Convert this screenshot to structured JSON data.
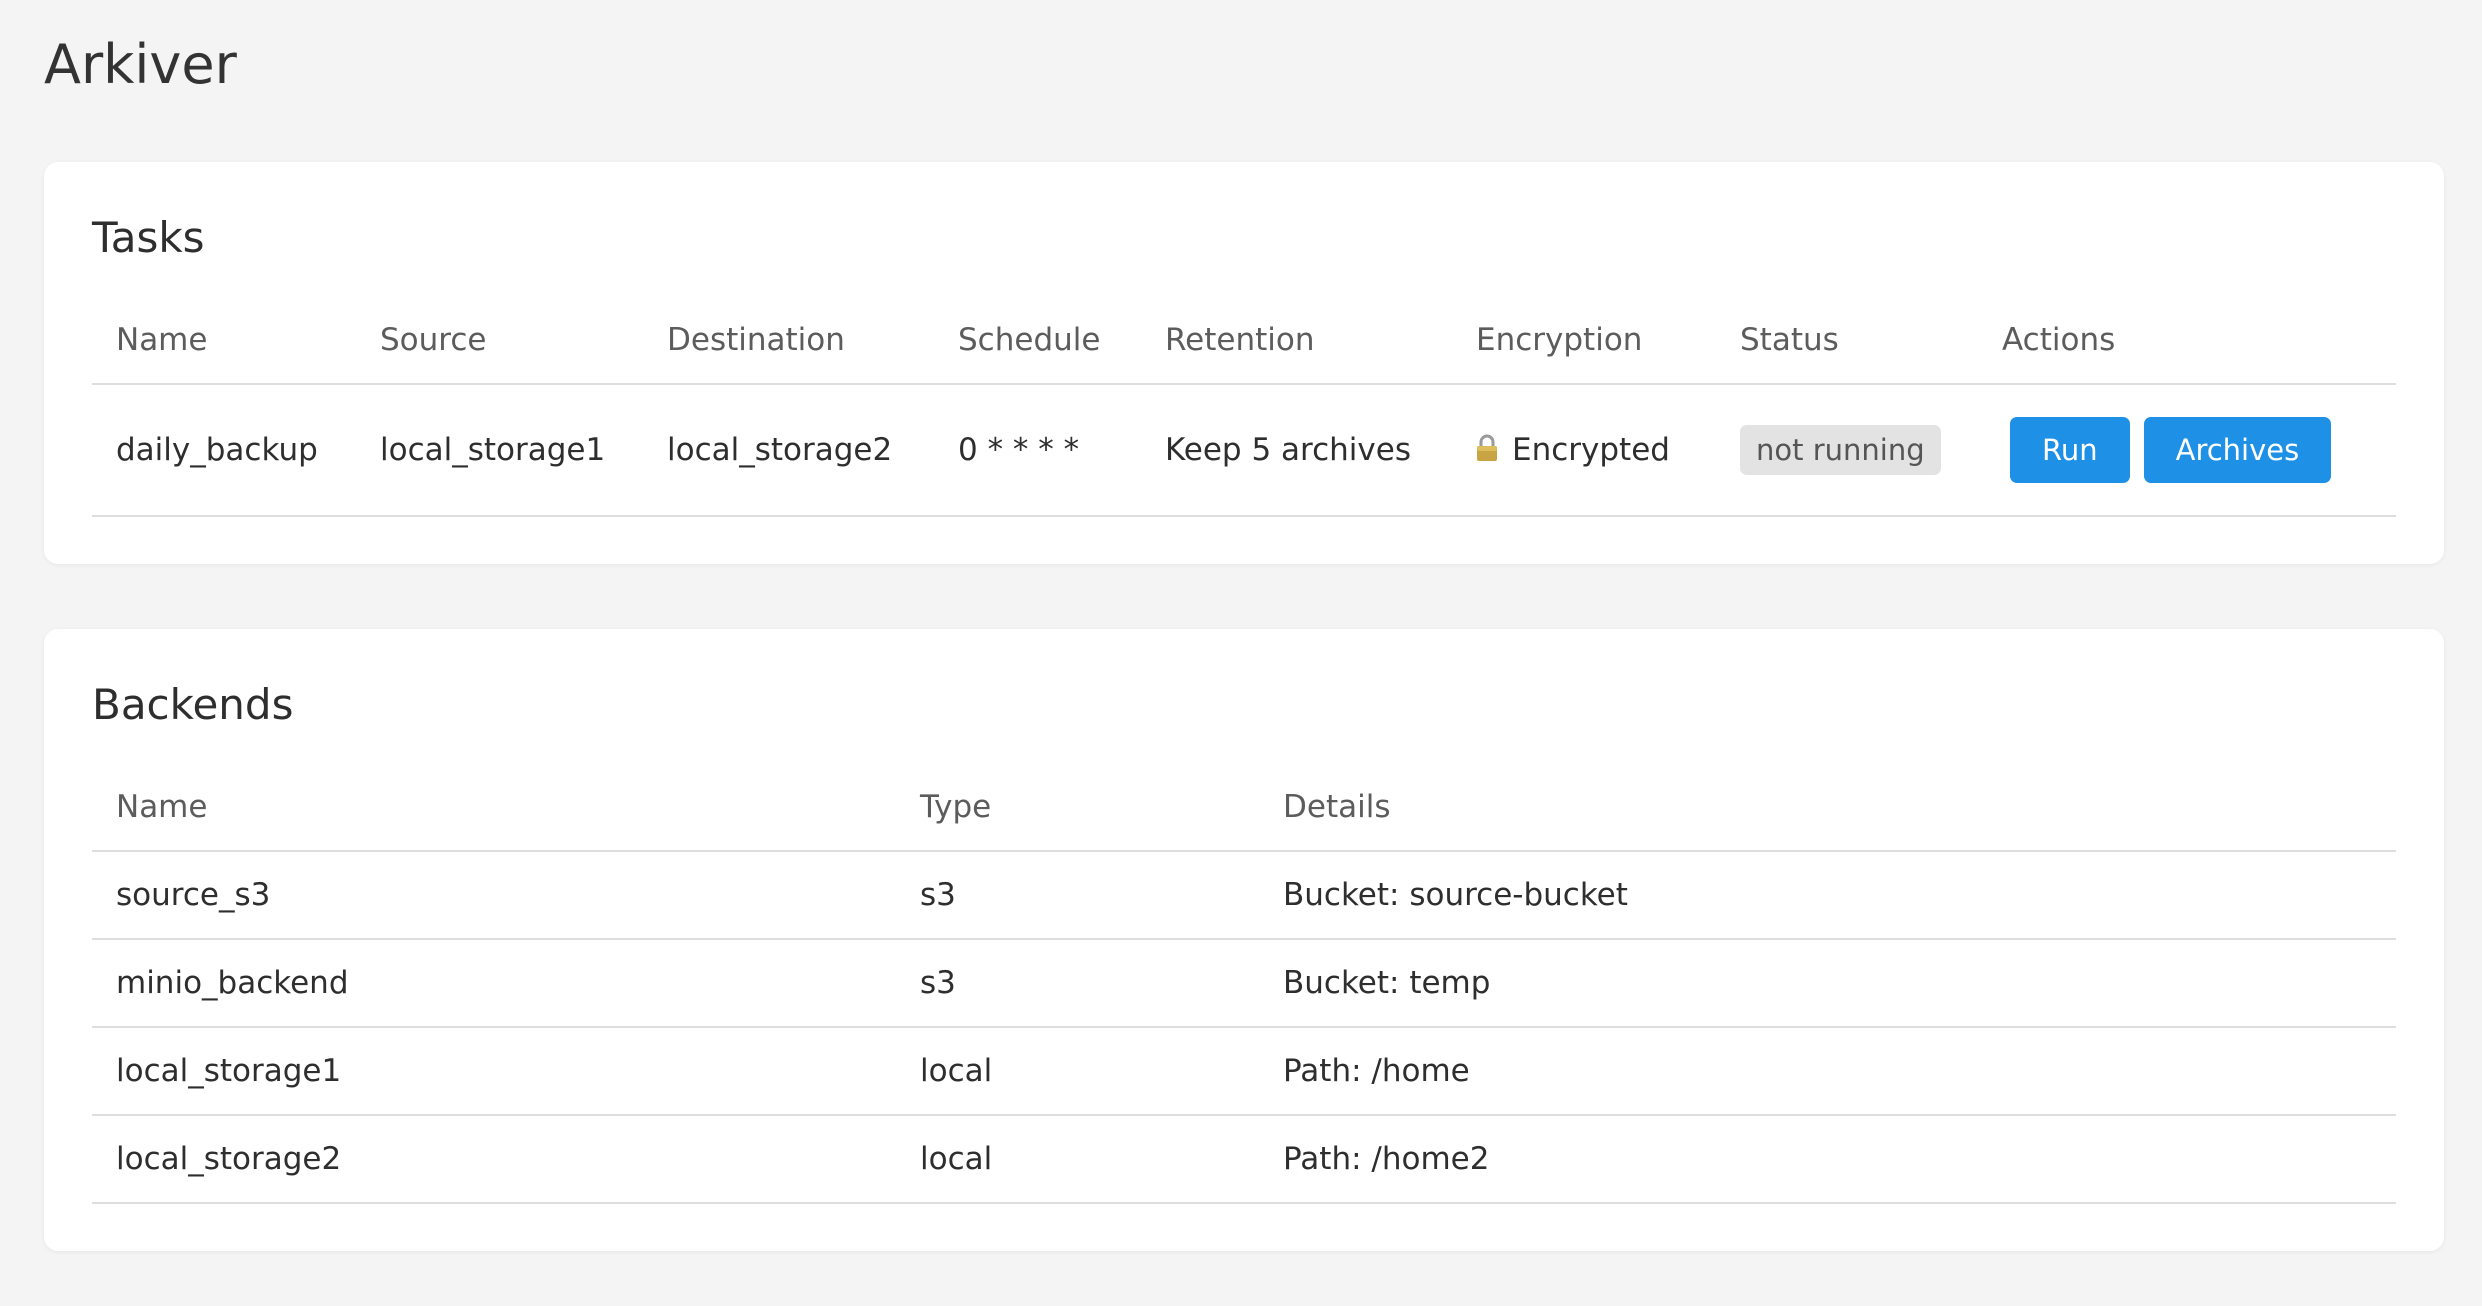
{
  "app": {
    "title": "Arkiver"
  },
  "tasks": {
    "heading": "Tasks",
    "columns": [
      "Name",
      "Source",
      "Destination",
      "Schedule",
      "Retention",
      "Encryption",
      "Status",
      "Actions"
    ],
    "rows": [
      {
        "name": "daily_backup",
        "source": "local_storage1",
        "destination": "local_storage2",
        "schedule": "0 * * * *",
        "retention": "Keep 5 archives",
        "encryption": "Encrypted",
        "encryption_icon": "lock-icon",
        "status": "not running",
        "actions": {
          "run": "Run",
          "archives": "Archives"
        }
      }
    ]
  },
  "backends": {
    "heading": "Backends",
    "columns": [
      "Name",
      "Type",
      "Details"
    ],
    "rows": [
      {
        "name": "source_s3",
        "type": "s3",
        "details": "Bucket: source-bucket"
      },
      {
        "name": "minio_backend",
        "type": "s3",
        "details": "Bucket: temp"
      },
      {
        "name": "local_storage1",
        "type": "local",
        "details": "Path: /home"
      },
      {
        "name": "local_storage2",
        "type": "local",
        "details": "Path: /home2"
      }
    ]
  },
  "colors": {
    "accent": "#1e90e6",
    "background": "#f4f4f4",
    "card": "#ffffff",
    "badge_bg": "#e3e3e3"
  }
}
